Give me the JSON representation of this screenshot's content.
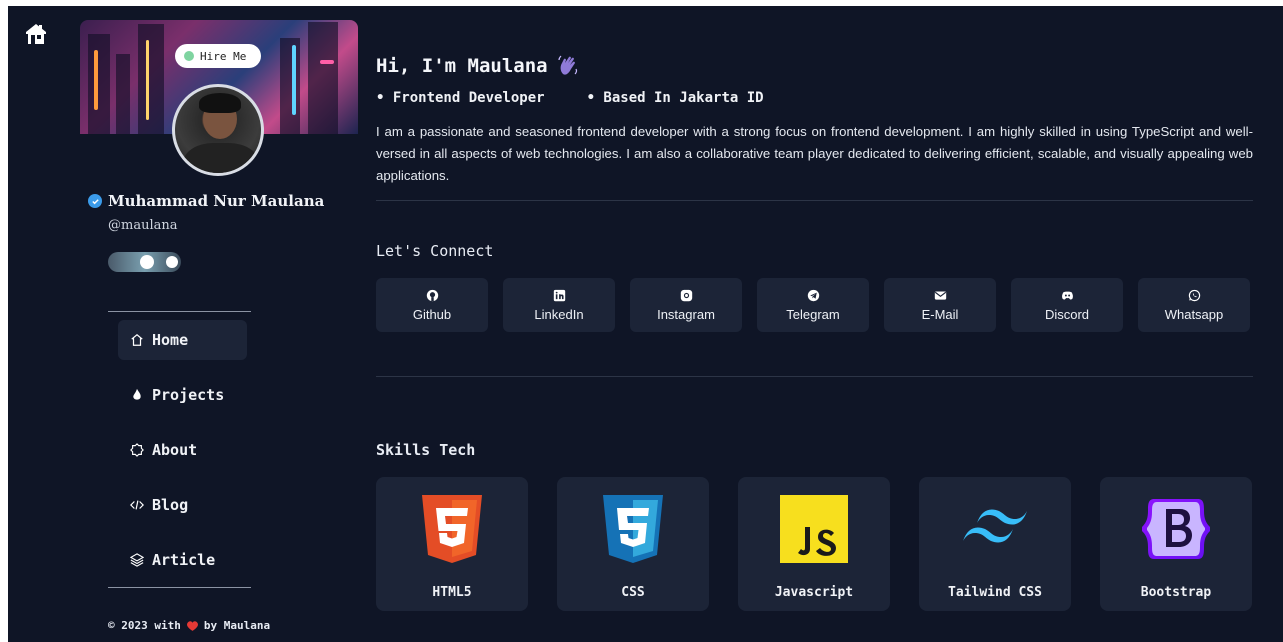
{
  "profile": {
    "hire_label": "Hire Me",
    "name": "Muhammad Nur Maulana",
    "handle": "@maulana"
  },
  "nav": {
    "items": [
      {
        "label": "Home",
        "icon": "home-icon",
        "active": true
      },
      {
        "label": "Projects",
        "icon": "flame-icon",
        "active": false
      },
      {
        "label": "About",
        "icon": "badge-icon",
        "active": false
      },
      {
        "label": "Blog",
        "icon": "code-icon",
        "active": false
      },
      {
        "label": "Article",
        "icon": "layers-icon",
        "active": false
      }
    ]
  },
  "footer": {
    "prefix": "© 2023 with",
    "suffix": "by Maulana"
  },
  "intro": {
    "greeting": "Hi, I'm Maulana",
    "roles": [
      "• Frontend Developer",
      "• Based In Jakarta ID"
    ],
    "bio": "I am a passionate and seasoned frontend developer with a strong focus on frontend development. I am highly skilled in using TypeScript and well-versed in all aspects of web technologies. I am also a collaborative team player dedicated to delivering efficient, scalable, and visually appealing web applications."
  },
  "connect": {
    "title": "Let's Connect",
    "links": [
      {
        "label": "Github",
        "icon": "github-icon"
      },
      {
        "label": "LinkedIn",
        "icon": "linkedin-icon"
      },
      {
        "label": "Instagram",
        "icon": "instagram-icon"
      },
      {
        "label": "Telegram",
        "icon": "telegram-icon"
      },
      {
        "label": "E-Mail",
        "icon": "mail-icon"
      },
      {
        "label": "Discord",
        "icon": "discord-icon"
      },
      {
        "label": "Whatsapp",
        "icon": "whatsapp-icon"
      }
    ]
  },
  "skills": {
    "title": "Skills Tech",
    "items": [
      {
        "label": "HTML5",
        "icon": "html5-logo"
      },
      {
        "label": "CSS",
        "icon": "css3-logo"
      },
      {
        "label": "Javascript",
        "icon": "javascript-logo"
      },
      {
        "label": "Tailwind CSS",
        "icon": "tailwind-logo"
      },
      {
        "label": "Bootstrap",
        "icon": "bootstrap-logo"
      }
    ]
  },
  "colors": {
    "background": "#0f1526",
    "card": "#1c2437",
    "accent_blue": "#3b9bea",
    "heart": "#e53935"
  }
}
